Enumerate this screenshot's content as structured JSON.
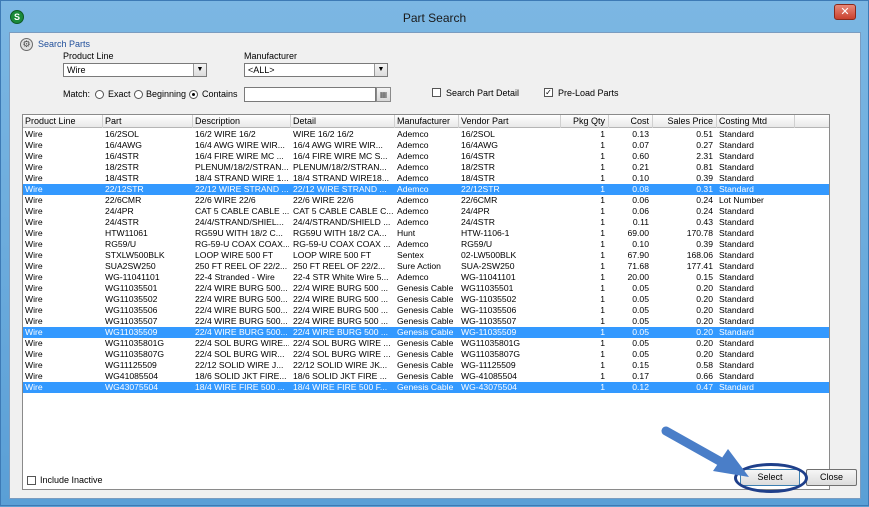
{
  "window": {
    "title": "Part Search",
    "close_glyph": "✕",
    "app_icon_letter": "S"
  },
  "search": {
    "group_label": "Search Parts",
    "product_line_label": "Product Line",
    "product_line_value": "Wire",
    "manufacturer_label": "Manufacturer",
    "manufacturer_value": "<ALL>",
    "match_label": "Match:",
    "match_options": [
      "Exact",
      "Beginning",
      "Contains"
    ],
    "match_selected": "Contains",
    "search_text": "",
    "search_part_detail_label": "Search Part Detail",
    "search_part_detail_checked": false,
    "preload_parts_label": "Pre-Load Parts",
    "preload_parts_checked": true
  },
  "grid": {
    "columns": [
      "Product Line",
      "Part",
      "Description",
      "Detail",
      "Manufacturer",
      "Vendor Part",
      "Pkg Qty",
      "Cost",
      "Sales Price",
      "Costing Mtd"
    ],
    "rows": [
      {
        "pl": "Wire",
        "part": "16/2SOL",
        "desc": "16/2 WIRE 16/2",
        "detail": "WIRE 16/2 16/2",
        "mfr": "Ademco",
        "vp": "16/2SOL",
        "qty": "1",
        "cost": "0.13",
        "price": "0.51",
        "mtd": "Standard",
        "sel": false
      },
      {
        "pl": "Wire",
        "part": "16/4AWG",
        "desc": "16/4 AWG WIRE WIR...",
        "detail": "16/4 AWG WIRE WIR...",
        "mfr": "Ademco",
        "vp": "16/4AWG",
        "qty": "1",
        "cost": "0.07",
        "price": "0.27",
        "mtd": "Standard",
        "sel": false
      },
      {
        "pl": "Wire",
        "part": "16/4STR",
        "desc": "16/4 FIRE WIRE MC ...",
        "detail": "16/4 FIRE WIRE MC S...",
        "mfr": "Ademco",
        "vp": "16/4STR",
        "qty": "1",
        "cost": "0.60",
        "price": "2.31",
        "mtd": "Standard",
        "sel": false
      },
      {
        "pl": "Wire",
        "part": "18/2STR",
        "desc": "PLENUM/18/2/STRAN...",
        "detail": "PLENUM/18/2/STRAN...",
        "mfr": "Ademco",
        "vp": "18/2STR",
        "qty": "1",
        "cost": "0.21",
        "price": "0.81",
        "mtd": "Standard",
        "sel": false
      },
      {
        "pl": "Wire",
        "part": "18/4STR",
        "desc": "18/4 STRAND WIRE 1...",
        "detail": "18/4 STRAND WIRE18...",
        "mfr": "Ademco",
        "vp": "18/4STR",
        "qty": "1",
        "cost": "0.10",
        "price": "0.39",
        "mtd": "Standard",
        "sel": false
      },
      {
        "pl": "Wire",
        "part": "22/12STR",
        "desc": "22/12 WIRE STRAND ...",
        "detail": "22/12 WIRE STRAND ...",
        "mfr": "Ademco",
        "vp": "22/12STR",
        "qty": "1",
        "cost": "0.08",
        "price": "0.31",
        "mtd": "Standard",
        "sel": true
      },
      {
        "pl": "Wire",
        "part": "22/6CMR",
        "desc": "22/6 WIRE 22/6",
        "detail": "22/6 WIRE 22/6",
        "mfr": "Ademco",
        "vp": "22/6CMR",
        "qty": "1",
        "cost": "0.06",
        "price": "0.24",
        "mtd": "Lot Number",
        "sel": false
      },
      {
        "pl": "Wire",
        "part": "24/4PR",
        "desc": "CAT 5 CABLE CABLE ...",
        "detail": "CAT 5 CABLE CABLE C...",
        "mfr": "Ademco",
        "vp": "24/4PR",
        "qty": "1",
        "cost": "0.06",
        "price": "0.24",
        "mtd": "Standard",
        "sel": false
      },
      {
        "pl": "Wire",
        "part": "24/4STR",
        "desc": "24/4/STRAND/SHIEL...",
        "detail": "24/4/STRAND/SHIELD ...",
        "mfr": "Ademco",
        "vp": "24/4STR",
        "qty": "1",
        "cost": "0.11",
        "price": "0.43",
        "mtd": "Standard",
        "sel": false
      },
      {
        "pl": "Wire",
        "part": "HTW11061",
        "desc": "RG59U WITH 18/2 C...",
        "detail": "RG59U WITH 18/2 CA...",
        "mfr": "Hunt",
        "vp": "HTW-1106-1",
        "qty": "1",
        "cost": "69.00",
        "price": "170.78",
        "mtd": "Standard",
        "sel": false
      },
      {
        "pl": "Wire",
        "part": "RG59/U",
        "desc": "RG-59-U COAX COAX...",
        "detail": "RG-59-U COAX COAX ...",
        "mfr": "Ademco",
        "vp": "RG59/U",
        "qty": "1",
        "cost": "0.10",
        "price": "0.39",
        "mtd": "Standard",
        "sel": false
      },
      {
        "pl": "Wire",
        "part": "STXLW500BLK",
        "desc": "LOOP WIRE 500 FT",
        "detail": "LOOP WIRE 500 FT",
        "mfr": "Sentex",
        "vp": "02-LW500BLK",
        "qty": "1",
        "cost": "67.90",
        "price": "168.06",
        "mtd": "Standard",
        "sel": false
      },
      {
        "pl": "Wire",
        "part": "SUA2SW250",
        "desc": "250 FT REEL OF 22/2...",
        "detail": "250 FT REEL OF 22/2...",
        "mfr": "Sure Action",
        "vp": "SUA-2SW250",
        "qty": "1",
        "cost": "71.68",
        "price": "177.41",
        "mtd": "Standard",
        "sel": false
      },
      {
        "pl": "Wire",
        "part": "WG-11041101",
        "desc": "22-4 Stranded - Wire",
        "detail": "22-4 STR White Wire 5...",
        "mfr": "Ademco",
        "vp": "WG-11041101",
        "qty": "1",
        "cost": "20.00",
        "price": "0.15",
        "mtd": "Standard",
        "sel": false
      },
      {
        "pl": "Wire",
        "part": "WG11035501",
        "desc": "22/4 WIRE BURG 500...",
        "detail": "22/4 WIRE BURG 500 ...",
        "mfr": "Genesis Cable",
        "vp": "WG11035501",
        "qty": "1",
        "cost": "0.05",
        "price": "0.20",
        "mtd": "Standard",
        "sel": false
      },
      {
        "pl": "Wire",
        "part": "WG11035502",
        "desc": "22/4 WIRE BURG 500...",
        "detail": "22/4 WIRE BURG 500 ...",
        "mfr": "Genesis Cable",
        "vp": "WG-11035502",
        "qty": "1",
        "cost": "0.05",
        "price": "0.20",
        "mtd": "Standard",
        "sel": false
      },
      {
        "pl": "Wire",
        "part": "WG11035506",
        "desc": "22/4 WIRE BURG 500...",
        "detail": "22/4 WIRE BURG 500 ...",
        "mfr": "Genesis Cable",
        "vp": "WG-11035506",
        "qty": "1",
        "cost": "0.05",
        "price": "0.20",
        "mtd": "Standard",
        "sel": false
      },
      {
        "pl": "Wire",
        "part": "WG11035507",
        "desc": "22/4 WIRE BURG 500...",
        "detail": "22/4 WIRE BURG 500 ...",
        "mfr": "Genesis Cable",
        "vp": "WG-11035507",
        "qty": "1",
        "cost": "0.05",
        "price": "0.20",
        "mtd": "Standard",
        "sel": false
      },
      {
        "pl": "Wire",
        "part": "WG11035509",
        "desc": "22/4 WIRE BURG 500...",
        "detail": "22/4 WIRE BURG 500 ...",
        "mfr": "Genesis Cable",
        "vp": "WG-11035509",
        "qty": "1",
        "cost": "0.05",
        "price": "0.20",
        "mtd": "Standard",
        "sel": true
      },
      {
        "pl": "Wire",
        "part": "WG11035801G",
        "desc": "22/4 SOL BURG WIRE...",
        "detail": "22/4 SOL BURG WIRE ...",
        "mfr": "Genesis Cable",
        "vp": "WG11035801G",
        "qty": "1",
        "cost": "0.05",
        "price": "0.20",
        "mtd": "Standard",
        "sel": false
      },
      {
        "pl": "Wire",
        "part": "WG11035807G",
        "desc": "22/4 SOL BURG WIR...",
        "detail": "22/4 SOL BURG WIRE ...",
        "mfr": "Genesis Cable",
        "vp": "WG11035807G",
        "qty": "1",
        "cost": "0.05",
        "price": "0.20",
        "mtd": "Standard",
        "sel": false
      },
      {
        "pl": "Wire",
        "part": "WG11125509",
        "desc": "22/12 SOLID WIRE J...",
        "detail": "22/12 SOLID WIRE JK...",
        "mfr": "Genesis Cable",
        "vp": "WG-11125509",
        "qty": "1",
        "cost": "0.15",
        "price": "0.58",
        "mtd": "Standard",
        "sel": false
      },
      {
        "pl": "Wire",
        "part": "WG41085504",
        "desc": "18/6 SOLID JKT FIRE...",
        "detail": "18/6 SOLID JKT FIRE ...",
        "mfr": "Genesis Cable",
        "vp": "WG-41085504",
        "qty": "1",
        "cost": "0.17",
        "price": "0.66",
        "mtd": "Standard",
        "sel": false
      },
      {
        "pl": "Wire",
        "part": "WG43075504",
        "desc": "18/4 WIRE FIRE 500 ...",
        "detail": "18/4 WIRE FIRE 500 F...",
        "mfr": "Genesis Cable",
        "vp": "WG-43075504",
        "qty": "1",
        "cost": "0.12",
        "price": "0.47",
        "mtd": "Standard",
        "sel": true
      }
    ]
  },
  "footer": {
    "include_inactive_label": "Include Inactive",
    "include_inactive_checked": false,
    "select_label": "Select",
    "close_label": "Close"
  },
  "colors": {
    "selection": "#3399ff",
    "annotation": "#1f3f8a",
    "arrow": "#4a7ec8"
  }
}
